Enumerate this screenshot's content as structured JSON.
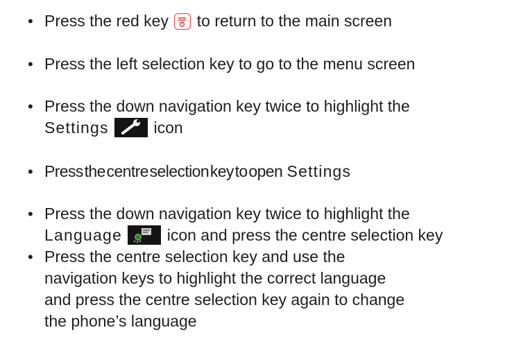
{
  "steps": [
    {
      "bullet": "•",
      "parts": [
        "Press the red key",
        "to return to the main screen"
      ]
    },
    {
      "bullet": "•",
      "lines": [
        "Press the left selection key to go to the menu screen"
      ]
    },
    {
      "bullet": "•",
      "lines": [
        "Press the down navigation key twice to highlight the"
      ],
      "line2_before": "Settings",
      "line2_after": "icon"
    },
    {
      "bullet": "•",
      "text_a": "Press the centre selection key to open",
      "text_b": "Settings"
    },
    {
      "bullet": "•",
      "lines": [
        "Press the down navigation key twice to highlight the"
      ],
      "line2_before": "Language",
      "line2_after": "icon and press the centre selection key"
    },
    {
      "bullet": "•",
      "lines": [
        "Press the centre selection key and use the",
        "navigation keys to highlight the correct language",
        "and press the centre selection key again to change",
        "the phone’s language"
      ]
    }
  ],
  "icons": {
    "red_key": "red-end-call-key-icon",
    "settings": "wrench-settings-icon",
    "language": "language-settings-icon"
  },
  "colors": {
    "text": "#1e1e1e",
    "red_key": "#d94a4a",
    "icon_bg": "#141414"
  }
}
